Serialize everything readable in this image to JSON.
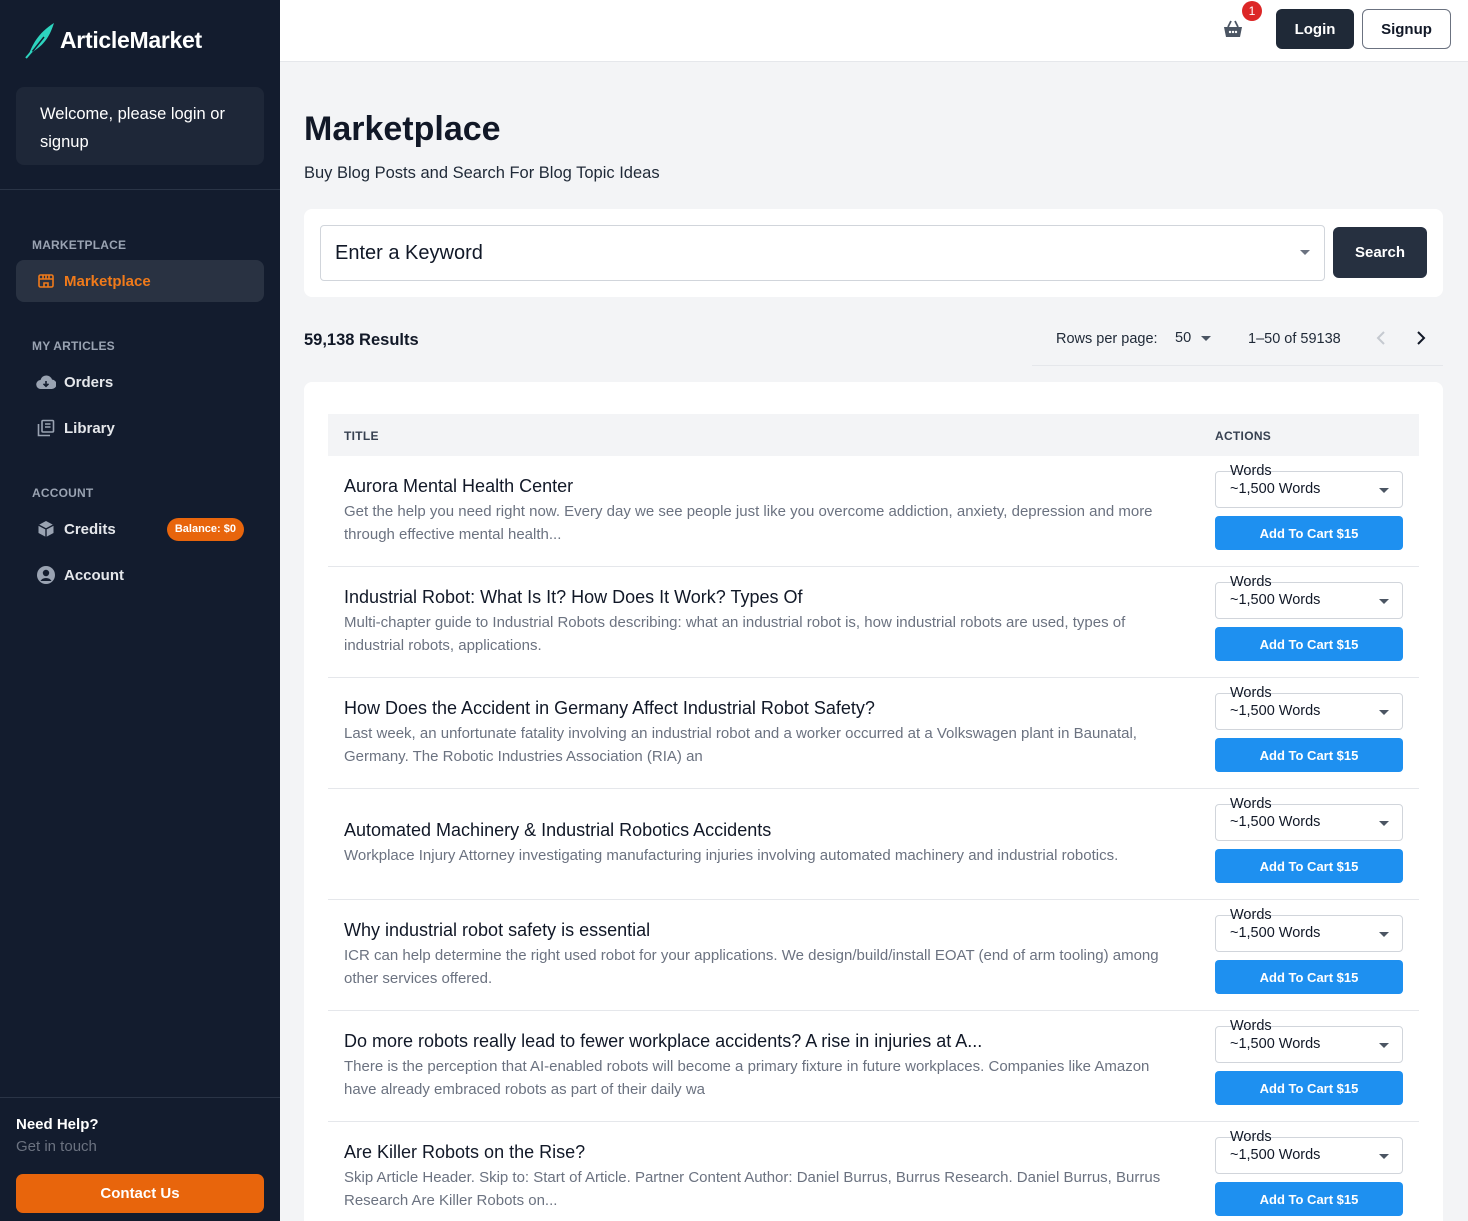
{
  "brand": {
    "name": "ArticleMarket",
    "accent": "#e8650c",
    "sidebar_bg": "#131c2e"
  },
  "sidebar": {
    "welcome": "Welcome, please login or signup",
    "sections": [
      {
        "label": "MARKETPLACE",
        "items": [
          {
            "label": "Marketplace",
            "icon": "storefront-icon",
            "active": true
          }
        ]
      },
      {
        "label": "MY ARTICLES",
        "items": [
          {
            "label": "Orders",
            "icon": "cloud-download-icon"
          },
          {
            "label": "Library",
            "icon": "library-icon"
          }
        ]
      },
      {
        "label": "ACCOUNT",
        "items": [
          {
            "label": "Credits",
            "icon": "cube-icon",
            "badge": "Balance: $0"
          },
          {
            "label": "Account",
            "icon": "user-circle-icon"
          }
        ]
      }
    ],
    "help_title": "Need Help?",
    "help_sub": "Get in touch",
    "contact_label": "Contact Us"
  },
  "topbar": {
    "cart_count": "1",
    "login_label": "Login",
    "signup_label": "Signup"
  },
  "main": {
    "title": "Marketplace",
    "subtitle": "Buy Blog Posts and Search For Blog Topic Ideas",
    "search": {
      "placeholder": "Enter a Keyword",
      "button_label": "Search"
    },
    "results_count": "59,138 Results",
    "pager": {
      "rows_label": "Rows per page:",
      "rows_value": "50",
      "range": "1–50 of 59138"
    },
    "table": {
      "columns": [
        "TITLE",
        "ACTIONS"
      ],
      "rows": [
        {
          "title": "Aurora Mental Health Center",
          "desc": "Get the help you need right now. Every day we see people just like you overcome addiction, anxiety, depression and more through effective mental health...",
          "words_label": "Words",
          "words_value": "~1,500 Words",
          "cart_label": "Add To Cart $15"
        },
        {
          "title": "Industrial Robot: What Is It? How Does It Work? Types Of",
          "desc": "Multi-chapter guide to Industrial Robots describing: what an industrial robot is, how industrial robots are used, types of industrial robots, applications.",
          "words_label": "Words",
          "words_value": "~1,500 Words",
          "cart_label": "Add To Cart $15"
        },
        {
          "title": "How Does the Accident in Germany Affect Industrial Robot Safety?",
          "desc": "Last week, an unfortunate fatality involving an industrial robot and a worker occurred at a Volkswagen plant in Baunatal, Germany. The Robotic Industries Association (RIA) an",
          "words_label": "Words",
          "words_value": "~1,500 Words",
          "cart_label": "Add To Cart $15"
        },
        {
          "title": "Automated Machinery & Industrial Robotics Accidents",
          "desc": "Workplace Injury Attorney investigating manufacturing injuries involving automated machinery and industrial robotics.",
          "words_label": "Words",
          "words_value": "~1,500 Words",
          "cart_label": "Add To Cart $15"
        },
        {
          "title": "Why industrial robot safety is essential",
          "desc": "ICR can help determine the right used robot for your applications. We design/build/install EOAT (end of arm tooling) among other services offered.",
          "words_label": "Words",
          "words_value": "~1,500 Words",
          "cart_label": "Add To Cart $15"
        },
        {
          "title": "Do more robots really lead to fewer workplace accidents? A rise in injuries at A...",
          "desc": "There is the perception that AI-enabled robots will become a primary fixture in future workplaces. Companies like Amazon have already embraced robots as part of their daily wa",
          "words_label": "Words",
          "words_value": "~1,500 Words",
          "cart_label": "Add To Cart $15"
        },
        {
          "title": "Are Killer Robots on the Rise?",
          "desc": "Skip Article Header. Skip to: Start of Article. Partner Content Author: Daniel Burrus, Burrus Research. Daniel Burrus, Burrus Research Are Killer Robots on...",
          "words_label": "Words",
          "words_value": "~1,500 Words",
          "cart_label": "Add To Cart $15"
        }
      ]
    }
  }
}
